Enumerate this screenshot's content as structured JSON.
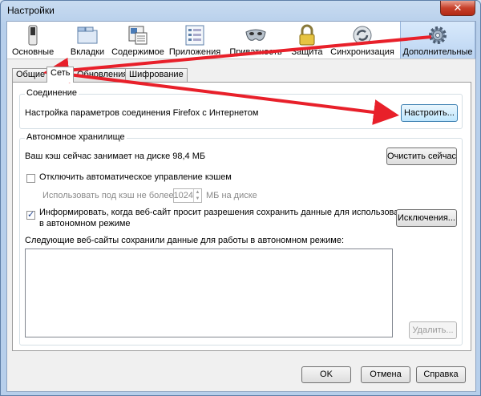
{
  "window": {
    "title": "Настройки",
    "close_label": "✕"
  },
  "toolbar": {
    "items": [
      {
        "label": "Основные"
      },
      {
        "label": "Вкладки"
      },
      {
        "label": "Содержимое"
      },
      {
        "label": "Приложения"
      },
      {
        "label": "Приватность"
      },
      {
        "label": "Защита"
      },
      {
        "label": "Синхронизация"
      },
      {
        "label": "Дополнительные"
      }
    ]
  },
  "tabs": [
    {
      "label": "Общие"
    },
    {
      "label": "Сеть"
    },
    {
      "label": "Обновления"
    },
    {
      "label": "Шифрование"
    }
  ],
  "connection": {
    "legend": "Соединение",
    "description": "Настройка параметров соединения Firefox с Интернетом",
    "configure_button": "Настроить..."
  },
  "offline": {
    "legend": "Автономное хранилище",
    "cache_usage": "Ваш кэш сейчас занимает на диске 98,4 МБ",
    "clear_button": "Очистить сейчас",
    "override_label": "Отключить автоматическое управление кэшем",
    "limit_prefix": "Использовать под кэш не более",
    "limit_value": "1024",
    "limit_suffix": "МБ на диске",
    "notify_label_line1": "Информировать, когда веб-сайт просит разрешения сохранить данные для использования",
    "notify_label_line2": "в автономном режиме",
    "exceptions_button": "Исключения...",
    "sites_label": "Следующие веб-сайты сохранили данные для работы в автономном режиме:",
    "remove_button": "Удалить..."
  },
  "footer": {
    "ok": "OK",
    "cancel": "Отмена",
    "help": "Справка"
  },
  "colors": {
    "annotation_arrow": "#e8202a",
    "selected_tool": "#bcd5f2"
  }
}
